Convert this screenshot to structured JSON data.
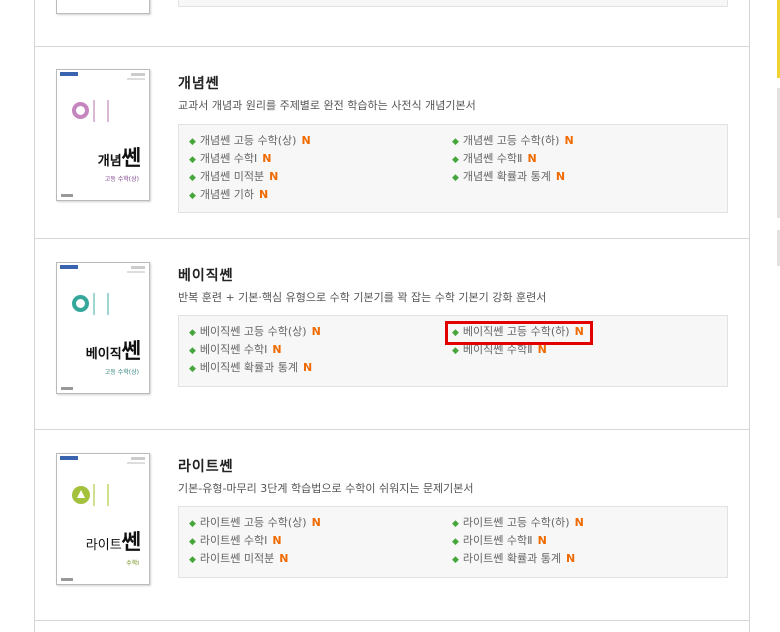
{
  "highlight_color": "#e30000",
  "new_badge_color": "#f06a00",
  "bullet_color": "#46a63c",
  "sections": [
    {
      "title": "개념쎈",
      "description": "교과서 개념과 원리를 주제별로 완전 학습하는 사전식 개념기본서",
      "cover_title_prefix": "개념",
      "cover_title_main": "쎈",
      "cover_sub": "고등 수학(상)",
      "items": [
        {
          "label": "개념쎈 고등 수학(상)",
          "badge": "N"
        },
        {
          "label": "개념쎈 고등 수학(하)",
          "badge": "N"
        },
        {
          "label": "개념쎈 수학Ⅰ",
          "badge": "N"
        },
        {
          "label": "개념쎈 수학Ⅱ",
          "badge": "N"
        },
        {
          "label": "개념쎈 미적분",
          "badge": "N"
        },
        {
          "label": "개념쎈 확률과 통계",
          "badge": "N"
        },
        {
          "label": "개념쎈 기하",
          "badge": "N"
        }
      ]
    },
    {
      "title": "베이직쎈",
      "description": "반복 훈련 + 기본·핵심 유형으로 수학 기본기를 꽉 잡는 수학 기본기 강화 훈련서",
      "cover_title_prefix": "베이직",
      "cover_title_main": "쎈",
      "cover_sub": "고등 수학(상)",
      "items": [
        {
          "label": "베이직쎈 고등 수학(상)",
          "badge": "N"
        },
        {
          "label": "베이직쎈 고등 수학(하)",
          "badge": "N"
        },
        {
          "label": "베이직쎈 수학Ⅰ",
          "badge": "N"
        },
        {
          "label": "베이직쎈 수학Ⅱ",
          "badge": "N"
        },
        {
          "label": "베이직쎈 확률과 통계",
          "badge": "N"
        }
      ]
    },
    {
      "title": "라이트쎈",
      "description": "기본-유형-마무리 3단계 학습법으로 수학이 쉬워지는 문제기본서",
      "cover_title_prefix": "라이트",
      "cover_title_main": "쎈",
      "cover_sub": "수학Ⅰ",
      "items": [
        {
          "label": "라이트쎈 고등 수학(상)",
          "badge": "N"
        },
        {
          "label": "라이트쎈 고등 수학(하)",
          "badge": "N"
        },
        {
          "label": "라이트쎈 수학Ⅰ",
          "badge": "N"
        },
        {
          "label": "라이트쎈 수학Ⅱ",
          "badge": "N"
        },
        {
          "label": "라이트쎈 미적분",
          "badge": "N"
        },
        {
          "label": "라이트쎈 확률과 통계",
          "badge": "N"
        }
      ]
    }
  ]
}
